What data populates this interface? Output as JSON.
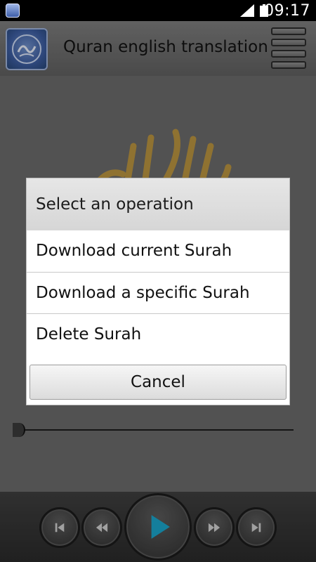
{
  "status_bar": {
    "time": "09:17",
    "icons": [
      "app-notification-icon",
      "signal-icon",
      "battery-icon"
    ]
  },
  "action_bar": {
    "title": "Quran english translation",
    "menu_icon": "menu-icon"
  },
  "player": {
    "progress": 0.0,
    "controls": [
      "previous-icon",
      "rewind-icon",
      "play-icon",
      "fast-forward-icon",
      "next-icon"
    ],
    "accent_color": "#1aa3c8"
  },
  "dialog": {
    "title": "Select an operation",
    "items": [
      {
        "label": "Download current Surah"
      },
      {
        "label": "Download a specific Surah"
      },
      {
        "label": "Delete Surah"
      }
    ],
    "cancel_label": "Cancel"
  }
}
